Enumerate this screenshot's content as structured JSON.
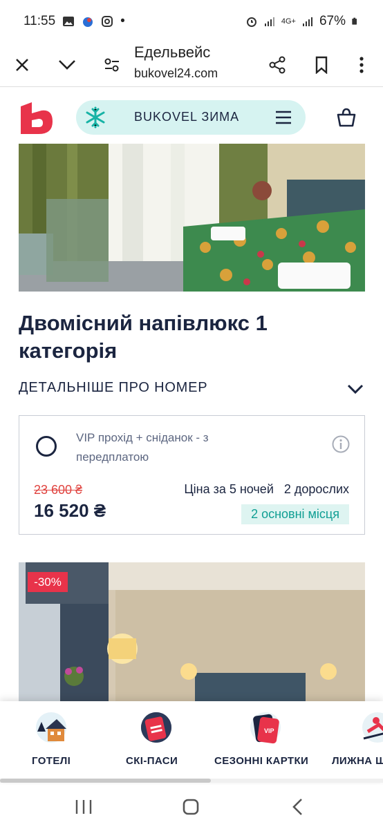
{
  "status_bar": {
    "time": "11:55",
    "dot": "•",
    "network": "4G+",
    "battery": "67%"
  },
  "browser": {
    "page_title": "Едельвейс",
    "domain": "bukovel24.com"
  },
  "header": {
    "season_label": "BUKOVEL ЗИМА"
  },
  "room": {
    "title": "Двомісний напівлюкс 1 категорія",
    "details_label": "ДЕТАЛЬНІШЕ ПРО НОМЕР"
  },
  "offer": {
    "name": "VIP прохід + сніданок - з передплатою",
    "old_price": "23 600 ₴",
    "new_price": "16 520 ₴",
    "nights": "Ціна за 5 ночей",
    "guests": "2 дорослих",
    "places": "2 основні місця",
    "selected": false
  },
  "next_room": {
    "discount": "-30%"
  },
  "bottom_nav": {
    "items": [
      {
        "label": "ГОТЕЛІ",
        "icon": "hotel-icon"
      },
      {
        "label": "СКІ-ПАСИ",
        "icon": "ski-pass-icon"
      },
      {
        "label": "СЕЗОННІ КАРТКИ",
        "icon": "season-card-icon"
      },
      {
        "label": "ЛИЖНА Ш",
        "icon": "ski-school-icon"
      }
    ],
    "scroll_fraction": 0.55
  },
  "colors": {
    "brand_red": "#e8334a",
    "navy": "#1b2540",
    "teal": "#0f9e93",
    "pill_bg": "#d6f3f1"
  }
}
